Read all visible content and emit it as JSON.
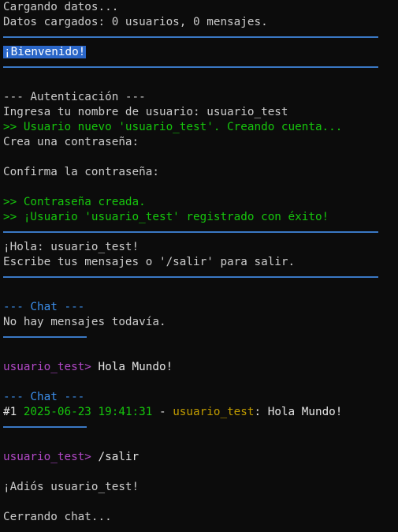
{
  "colors": {
    "background": "#0c0c0c",
    "text": "#cccccc",
    "selection": "#2a66c8",
    "rule": "#3a78c4",
    "success": "#16c60c",
    "chat_header": "#3b8eea",
    "prompt": "#b148c6",
    "username": "#c19c00"
  },
  "load": {
    "loading": "Cargando datos...",
    "loaded": "Datos cargados: 0 usuarios, 0 mensajes."
  },
  "welcome": "¡Bienvenido!",
  "auth": {
    "header": "--- Autenticación ---",
    "username_prompt": "Ingresa tu nombre de usuario: usuario_test",
    "new_user": ">> Usuario nuevo 'usuario_test'. Creando cuenta...",
    "create_password": "Crea una contraseña:",
    "confirm_password": "Confirma la contraseña:",
    "password_created": ">> Contraseña creada.",
    "registered": ">> ¡Usuario 'usuario_test' registrado con éxito!"
  },
  "greeting": {
    "hello": "¡Hola: usuario_test!",
    "instructions": "Escribe tus mensajes o '/salir' para salir."
  },
  "chat1": {
    "header": "--- Chat ---",
    "empty": "No hay mensajes todavía."
  },
  "input1": {
    "prompt": "usuario_test>",
    "text": " Hola Mundo!"
  },
  "chat2": {
    "header": "--- Chat ---",
    "message": {
      "index": "#1 ",
      "timestamp": "2025-06-23 19:41:31",
      "separator": " - ",
      "user": "usuario_test",
      "text": ": Hola Mundo!"
    }
  },
  "input2": {
    "prompt": "usuario_test>",
    "text": " /salir"
  },
  "goodbye": "¡Adiós usuario_test!",
  "closing": "Cerrando chat..."
}
